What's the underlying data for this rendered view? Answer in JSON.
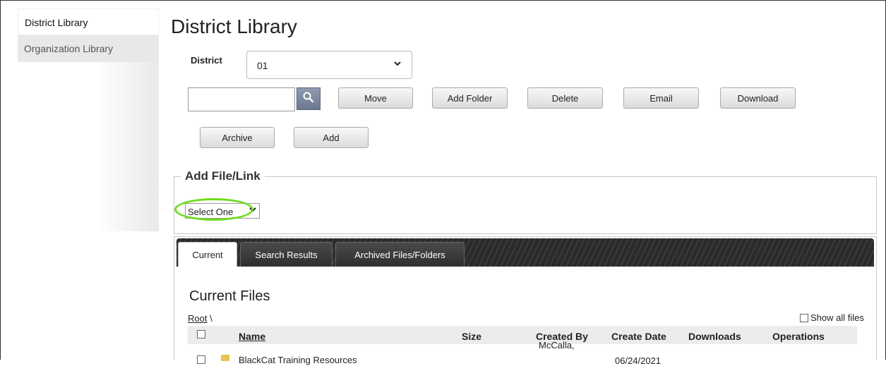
{
  "sidebar": {
    "items": [
      {
        "label": "District Library",
        "active": true
      },
      {
        "label": "Organization Library",
        "active": false
      }
    ]
  },
  "header": {
    "title": "District Library"
  },
  "district": {
    "label": "District",
    "value": "01"
  },
  "search": {
    "value": "",
    "placeholder": ""
  },
  "toolbar": {
    "move_label": "Move",
    "add_folder_label": "Add Folder",
    "delete_label": "Delete",
    "email_label": "Email",
    "download_label": "Download",
    "archive_label": "Archive",
    "add_label": "Add"
  },
  "add_file": {
    "legend": "Add File/Link",
    "select_value": "Select One"
  },
  "tabs": [
    {
      "label": "Current",
      "active": true
    },
    {
      "label": "Search Results",
      "active": false
    },
    {
      "label": "Archived Files/Folders",
      "active": false
    }
  ],
  "files": {
    "title": "Current Files",
    "breadcrumb_root": "Root",
    "breadcrumb_sep": "\\",
    "show_all_label": "Show all files",
    "columns": [
      "Name",
      "Size",
      "Created By",
      "Create Date",
      "Downloads",
      "Operations"
    ],
    "rows": [
      {
        "name": "BlackCat Training Resources",
        "size": "",
        "created_by": "McCalla,",
        "create_date": "06/24/2021",
        "downloads": "",
        "operations": ""
      }
    ]
  },
  "colors": {
    "highlight": "#6fdc1e",
    "tab_bar": "#2a2a2a",
    "search_button": "#7a879c"
  },
  "icons": {
    "search": "search-icon",
    "chevron": "chevron-down-icon",
    "folder": "folder-icon"
  }
}
